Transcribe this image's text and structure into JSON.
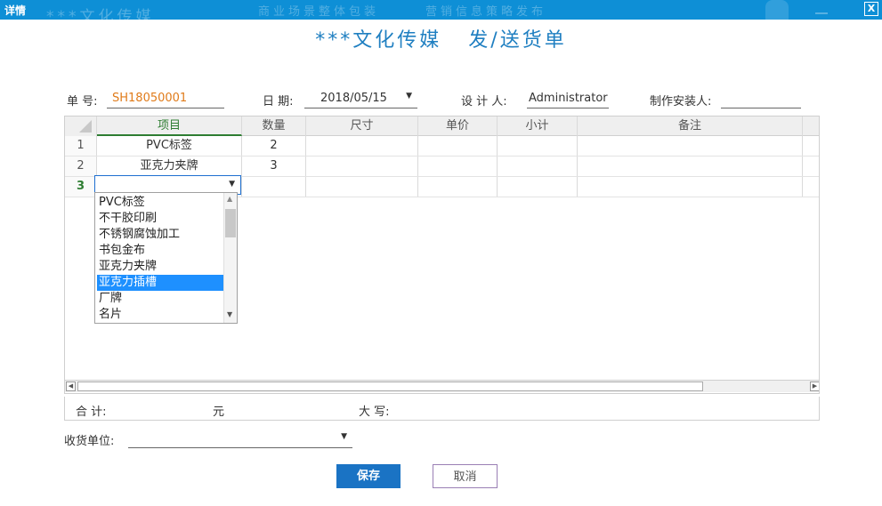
{
  "window": {
    "title": "详情",
    "close_label": "X",
    "ghost_texts": [
      "***文化传媒",
      "商业场景整体包装",
      "营销信息策略发布"
    ]
  },
  "form": {
    "heading": "***文化传媒   发/送货单",
    "order_no_label": "单  号:",
    "order_no_value": "SH18050001",
    "date_label": "日  期:",
    "date_value": "2018/05/15",
    "designer_label": "设  计 人:",
    "designer_value": "Administrator",
    "installer_label": "制作安装人:",
    "installer_value": ""
  },
  "grid": {
    "columns": [
      "项目",
      "数量",
      "尺寸",
      "单价",
      "小计",
      "备注"
    ],
    "rows": [
      {
        "num": "1",
        "item": "PVC标签",
        "qty": "2",
        "size": "",
        "price": "",
        "subtotal": "",
        "note": ""
      },
      {
        "num": "2",
        "item": "亚克力夹牌",
        "qty": "3",
        "size": "",
        "price": "",
        "subtotal": "",
        "note": ""
      },
      {
        "num": "3",
        "item": "",
        "qty": "",
        "size": "",
        "price": "",
        "subtotal": "",
        "note": ""
      }
    ]
  },
  "dropdown": {
    "options": [
      "PVC标签",
      "不干胶印刷",
      "不锈钢腐蚀加工",
      "书包金布",
      "亚克力夹牌",
      "亚克力插槽",
      "厂牌",
      "名片"
    ],
    "highlighted": "亚克力插槽"
  },
  "footer": {
    "total_label": "合   计:",
    "currency": "元",
    "uppercase_label": "大  写:"
  },
  "receiver": {
    "label": "收货单位:",
    "value": ""
  },
  "buttons": {
    "save": "保存",
    "cancel": "取消"
  },
  "colors": {
    "titlebar": "#0e8fd6",
    "heading": "#1f7fc1",
    "order_no": "#e07b1a",
    "active_col": "#2e7d32",
    "save_button": "#1a73c4",
    "selection": "#1e90ff"
  }
}
